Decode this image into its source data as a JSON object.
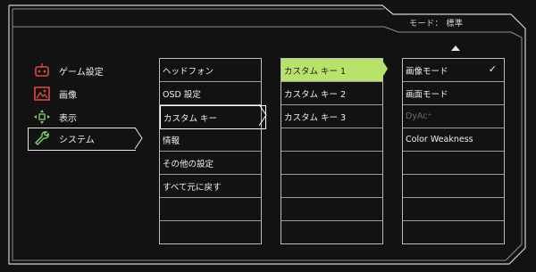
{
  "header": {
    "mode_label": "モード： 標準"
  },
  "categories": [
    {
      "label": "ゲーム設定",
      "icon": "game-controller-icon",
      "selected": false
    },
    {
      "label": "画像",
      "icon": "picture-icon",
      "selected": false
    },
    {
      "label": "表示",
      "icon": "display-arrows-icon",
      "selected": false
    },
    {
      "label": "システム",
      "icon": "wrench-icon",
      "selected": true
    }
  ],
  "submenu": {
    "items": [
      "ヘッドフォン",
      "OSD 設定",
      "カスタム キー",
      "情報",
      "その他の設定",
      "すべて元に戻す",
      "",
      "",
      ""
    ],
    "selected_index": 2
  },
  "custom_keys": {
    "items": [
      "カスタム キー 1",
      "カスタム キー 2",
      "カスタム キー 3",
      "",
      "",
      "",
      "",
      "",
      ""
    ],
    "highlighted_index": 0
  },
  "options": {
    "items": [
      "画像モード",
      "画面モード",
      "DyAc⁺",
      "Color Weakness",
      "",
      "",
      "",
      "",
      ""
    ],
    "checked_index": 0,
    "disabled_index": 2
  },
  "colors": {
    "accent_green": "#b8e36a",
    "icon_red": "#e0473c",
    "icon_green": "#7fd36e"
  }
}
